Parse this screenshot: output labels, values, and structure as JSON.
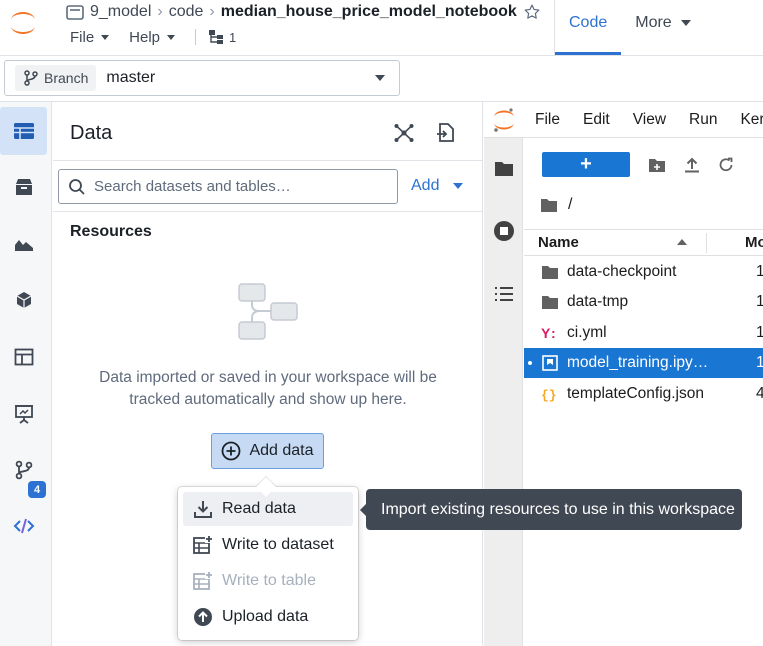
{
  "header": {
    "repo_name": "9_model",
    "crumb_code": "code",
    "notebook_title": "median_house_price_model_notebook",
    "menus": [
      "File",
      "Help"
    ],
    "repo_count": "1",
    "tabs": [
      "Code",
      "More"
    ],
    "active_tab": "Code"
  },
  "branch": {
    "chip_label": "Branch",
    "value": "master"
  },
  "rail": {
    "items": [
      "datasets",
      "packages",
      "charts",
      "models",
      "tables",
      "presentation",
      "branches",
      "code"
    ],
    "branch_badge": "4"
  },
  "data_panel": {
    "title": "Data",
    "search_placeholder": "Search datasets and tables…",
    "add_label": "Add",
    "resources_title": "Resources",
    "empty_text": "Data imported or saved in your workspace will be tracked automatically and show up here.",
    "add_data_label": "Add data"
  },
  "popover": {
    "items": [
      {
        "label": "Read data",
        "icon": "download-icon",
        "state": "hover"
      },
      {
        "label": "Write to dataset",
        "icon": "table-add-icon",
        "state": "normal"
      },
      {
        "label": "Write to table",
        "icon": "table-add-icon",
        "state": "disabled"
      },
      {
        "label": "Upload data",
        "icon": "upload-circle-icon",
        "state": "normal"
      }
    ]
  },
  "tooltip": {
    "text": "Import existing resources to use in this workspace"
  },
  "jupyter": {
    "menus": [
      "File",
      "Edit",
      "View",
      "Run",
      "Kerne"
    ],
    "new_button": "+",
    "path": "/",
    "column_name": "Name",
    "column_modified": "Mo",
    "files": [
      {
        "name": "data-checkpoint",
        "type": "folder",
        "modified": "1",
        "selected": false
      },
      {
        "name": "data-tmp",
        "type": "folder",
        "modified": "1",
        "selected": false
      },
      {
        "name": "ci.yml",
        "type": "yaml",
        "modified": "1",
        "selected": false
      },
      {
        "name": "model_training.ipy…",
        "type": "notebook",
        "modified": "1",
        "selected": true
      },
      {
        "name": "templateConfig.json",
        "type": "json",
        "modified": "4",
        "selected": false
      }
    ]
  },
  "colors": {
    "accent": "#2d72d2",
    "jupyter_blue": "#1976d2",
    "jupyter_orange": "#f37626",
    "tooltip_bg": "#404854"
  }
}
